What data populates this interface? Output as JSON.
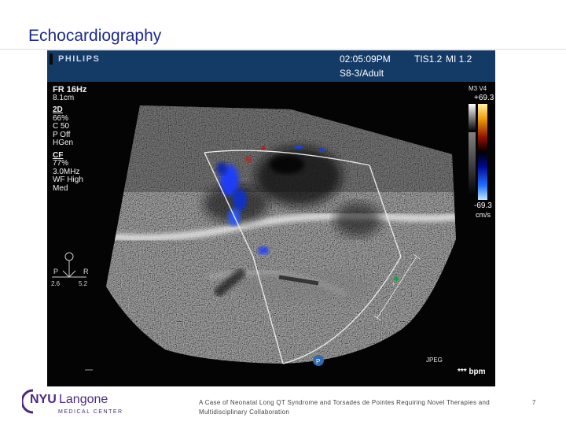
{
  "slide": {
    "title": "Echocardiography",
    "footer": "A Case of Neonatal Long QT Syndrome and Torsades de Pointes Requiring Novel Therapies and Multidisciplinary Collaboration",
    "page_number": "7"
  },
  "logo": {
    "name_part1": "NYU",
    "name_part2": "Langone",
    "subtitle": "MEDICAL CENTER",
    "color": "#4a2a82"
  },
  "echo": {
    "brand": "PHILIPS",
    "time": "02:05:09PM",
    "tis": "TIS1.2",
    "mi": "MI 1.2",
    "probe": "S8-3/Adult",
    "frame_rate": "FR 16Hz",
    "depth": "8.1cm",
    "mode_2d": "2D",
    "gain_2d": "66%",
    "c_2d": "C 50",
    "p_2d": "P Off",
    "gen_2d": "HGen",
    "mode_cf": "CF",
    "gain_cf": "77%",
    "freq_cf": "3.0MHz",
    "wf_cf": "WF High",
    "med_cf": "Med",
    "colorbar_label": "M3 V4",
    "velocity_max": "+69.3",
    "velocity_min": "-69.3",
    "velocity_unit": "cm/s",
    "orient_left": "P",
    "orient_right": "R",
    "orient_left_val": "2.6",
    "orient_right_val": "5.2",
    "format": "JPEG",
    "heart_rate": "*** bpm"
  },
  "colors": {
    "title": "#1f2a8a",
    "echo_header": "#143a66",
    "doppler_blue": "#1a3cff",
    "doppler_red": "#c81818"
  }
}
